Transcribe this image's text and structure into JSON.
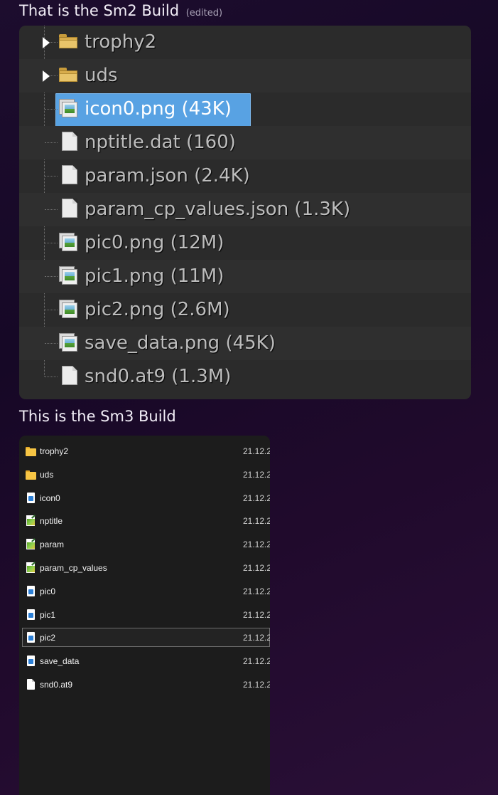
{
  "message1": {
    "text": "That is the Sm2 Build",
    "edited_label": "(edited)"
  },
  "message2": {
    "text": "This is the Sm3 Build"
  },
  "tree": {
    "items": [
      {
        "label": "trophy2",
        "kind": "folder",
        "expander": true
      },
      {
        "label": "uds",
        "kind": "folder",
        "expander": true
      },
      {
        "label": "icon0.png (43K)",
        "kind": "image",
        "selected": true
      },
      {
        "label": "nptitle.dat (160)",
        "kind": "file"
      },
      {
        "label": "param.json (2.4K)",
        "kind": "file"
      },
      {
        "label": "param_cp_values.json (1.3K)",
        "kind": "file"
      },
      {
        "label": "pic0.png (12M)",
        "kind": "image"
      },
      {
        "label": "pic1.png (11M)",
        "kind": "image"
      },
      {
        "label": "pic2.png (2.6M)",
        "kind": "image"
      },
      {
        "label": "save_data.png (45K)",
        "kind": "image"
      },
      {
        "label": "snd0.at9 (1.3M)",
        "kind": "file"
      }
    ]
  },
  "explorer": {
    "items": [
      {
        "name": "trophy2",
        "date": "21.12.2",
        "kind": "folder"
      },
      {
        "name": "uds",
        "date": "21.12.2",
        "kind": "folder"
      },
      {
        "name": "icon0",
        "date": "21.12.2",
        "kind": "image"
      },
      {
        "name": "nptitle",
        "date": "21.12.2",
        "kind": "app"
      },
      {
        "name": "param",
        "date": "21.12.2",
        "kind": "app"
      },
      {
        "name": "param_cp_values",
        "date": "21.12.2",
        "kind": "app"
      },
      {
        "name": "pic0",
        "date": "21.12.2",
        "kind": "image"
      },
      {
        "name": "pic1",
        "date": "21.12.2",
        "kind": "image"
      },
      {
        "name": "pic2",
        "date": "21.12.2",
        "kind": "image",
        "selected": true
      },
      {
        "name": "save_data",
        "date": "21.12.2",
        "kind": "image"
      },
      {
        "name": "snd0.at9",
        "date": "21.12.2",
        "kind": "blank"
      }
    ]
  }
}
